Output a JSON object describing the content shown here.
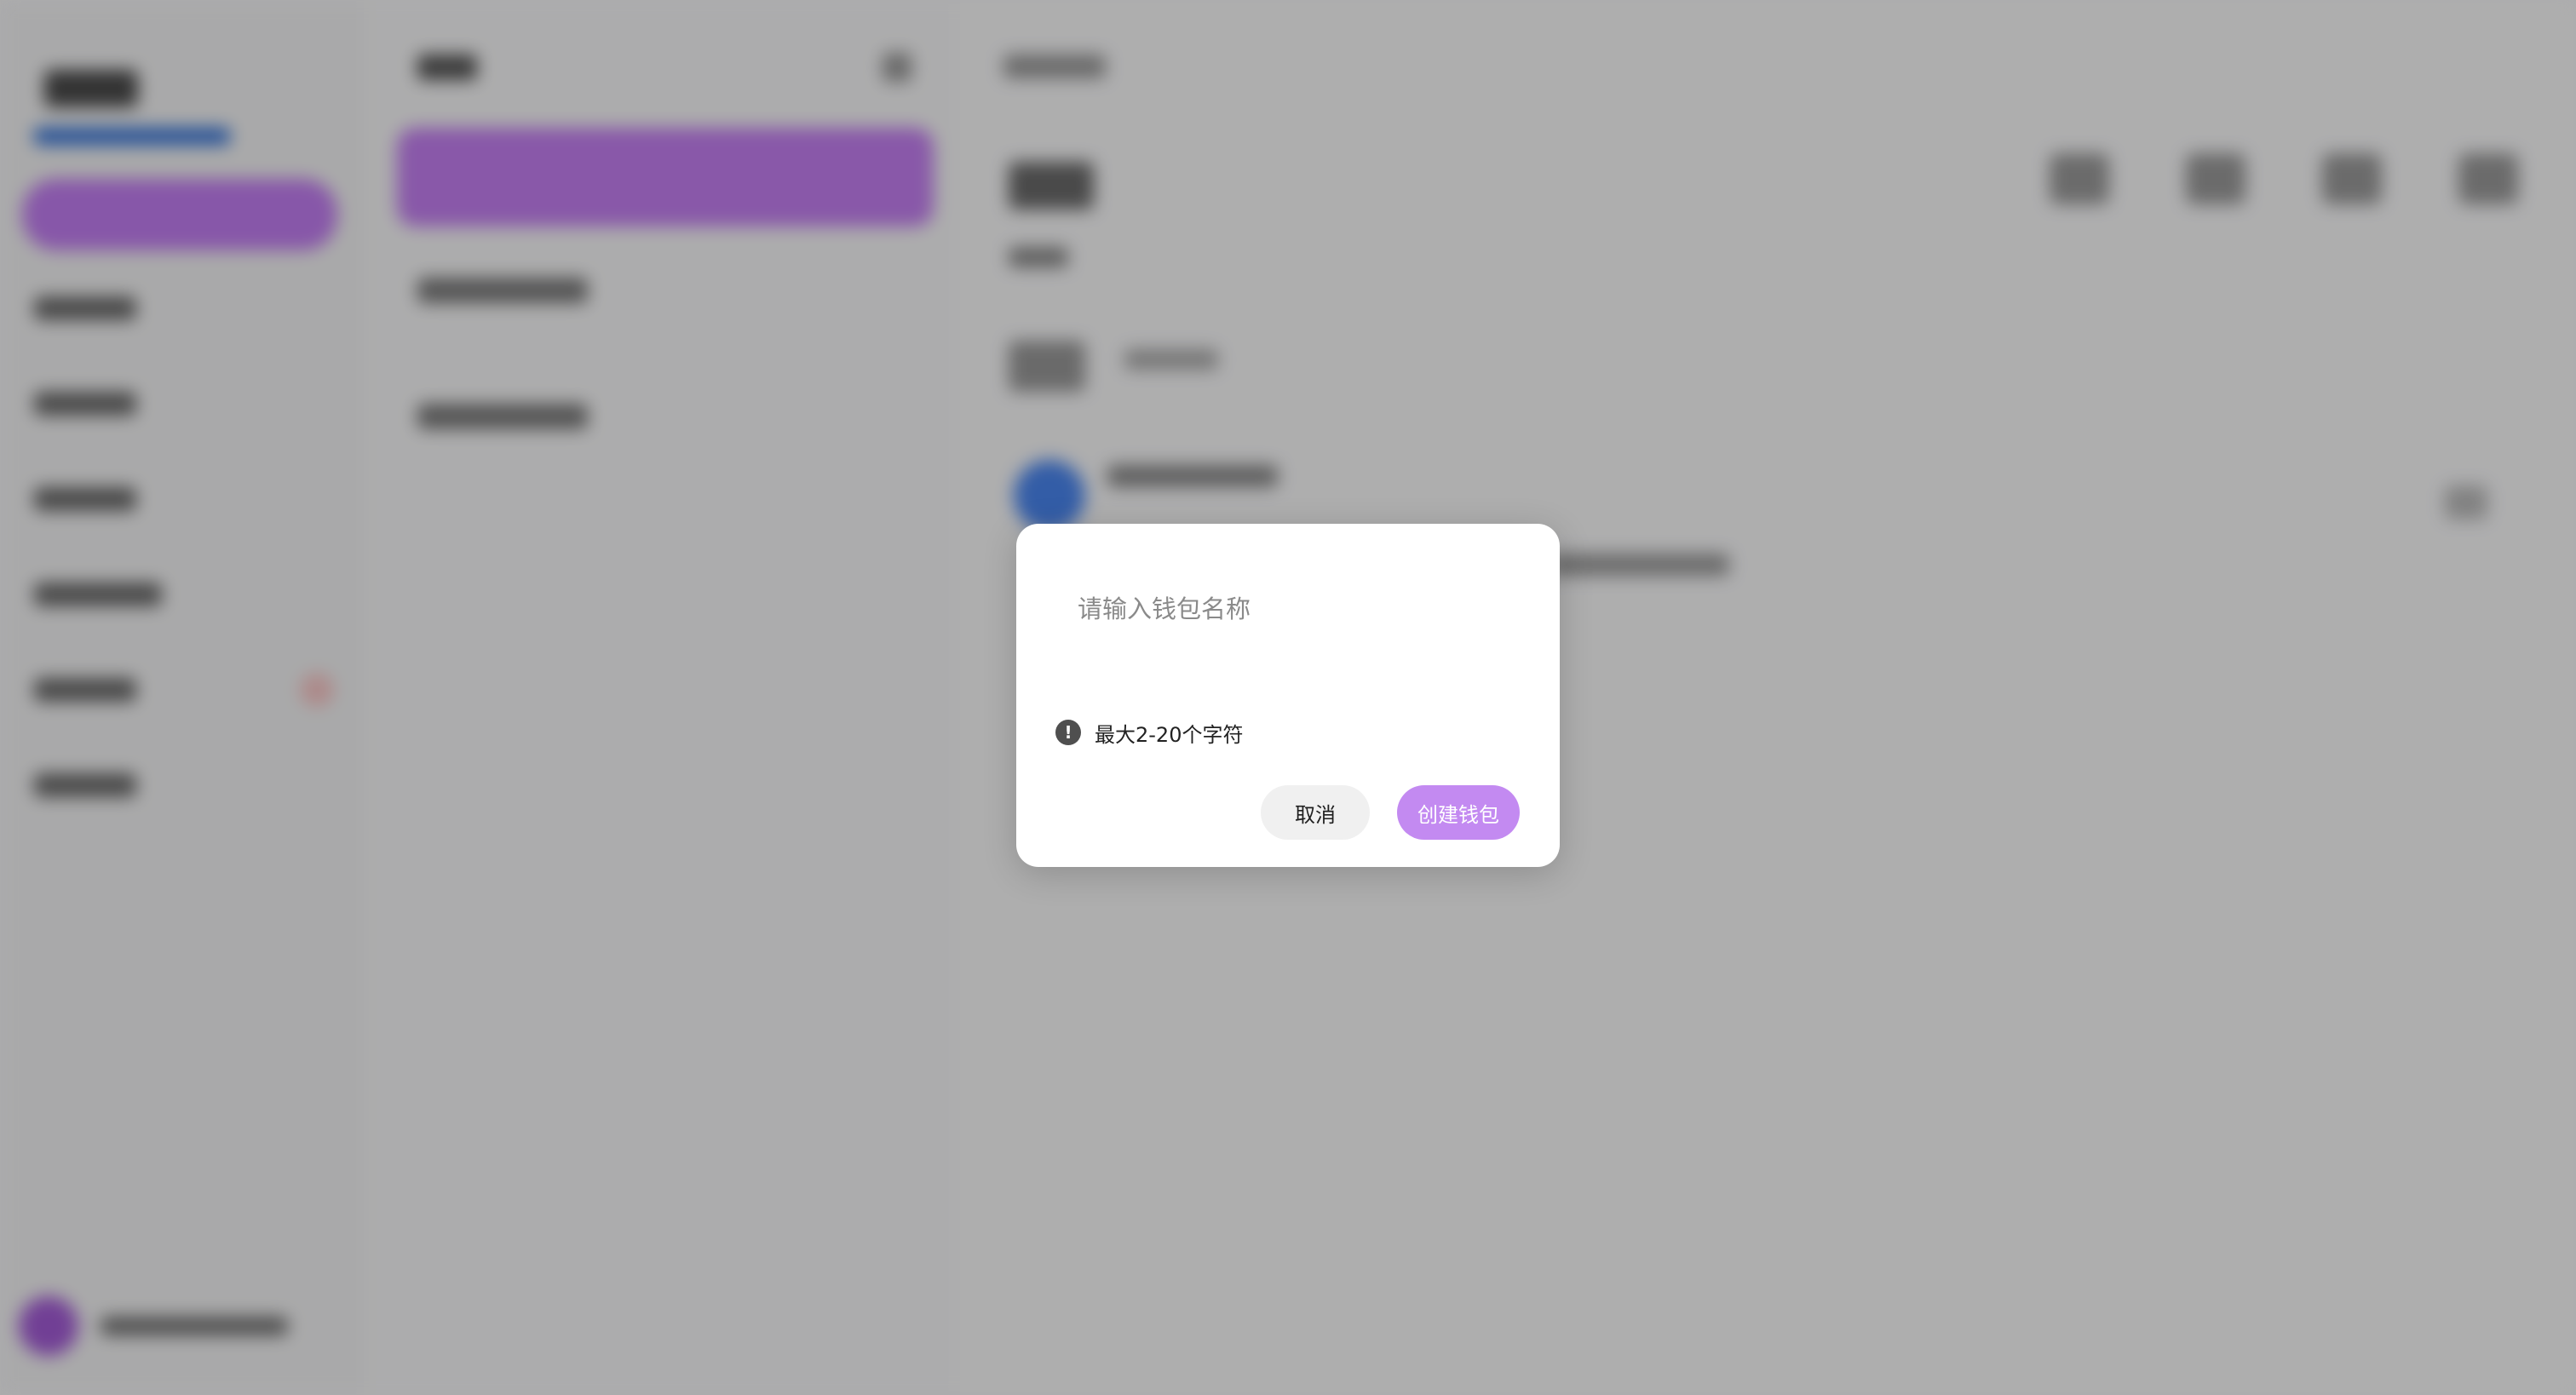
{
  "dialog": {
    "input_placeholder": "请输入钱包名称",
    "input_value": "",
    "hint_icon": "exclamation-circle-icon",
    "hint_text": "最大2-20个字符",
    "cancel_label": "取消",
    "create_label": "创建钱包"
  },
  "colors": {
    "accent": "#c38af1",
    "cancel_bg": "#f0f0f0",
    "overlay": "rgba(0,0,0,0.3)"
  }
}
